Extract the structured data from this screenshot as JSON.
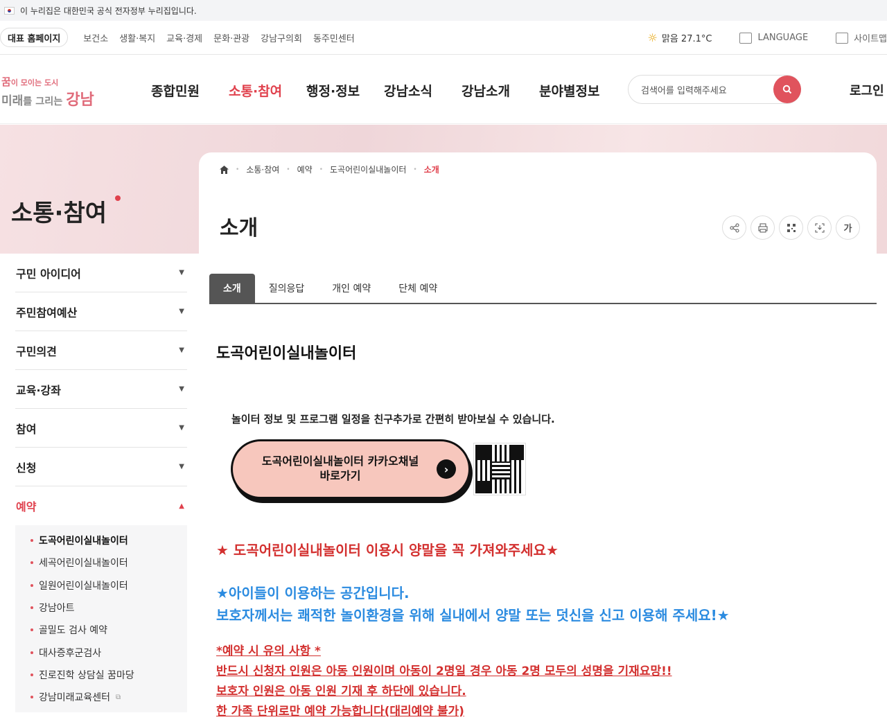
{
  "gov_notice": "이 누리집은 대한민국 공식 전자정부 누리집입니다.",
  "util": {
    "home_label": "대표 홈페이지",
    "links": [
      "보건소",
      "생활·복지",
      "교육·경제",
      "문화·관광",
      "강남구의회",
      "동주민센터"
    ],
    "weather": "맑음  27.1°C",
    "language": "LANGUAGE",
    "sitemap": "사이트맵"
  },
  "logo": {
    "line1a": "꿈",
    "line1b": "이 모이는 도시",
    "line2a": "미래",
    "line2b": "를 그리는 ",
    "line2c": "강남"
  },
  "gnb": {
    "items": [
      "종합민원",
      "소통·참여",
      "행정·정보",
      "강남소식",
      "강남소개",
      "분야별정보"
    ],
    "active_index": 1
  },
  "search": {
    "placeholder": "검색어를 입력해주세요"
  },
  "login": "로그인",
  "section_title": "소통·참여",
  "breadcrumb": [
    "소통·참여",
    "예약",
    "도곡어린이실내놀이터",
    "소개"
  ],
  "page_title": "소개",
  "tools": [
    "share-icon",
    "print-icon",
    "qr-icon",
    "download-icon",
    "font-size-icon"
  ],
  "font_tool_label": "가",
  "lnb": {
    "items": [
      "구민 아이디어",
      "주민참여예산",
      "구민의견",
      "교육·강좌",
      "참여",
      "신청",
      "예약"
    ],
    "sub": [
      "도곡어린이실내놀이터",
      "세곡어린이실내놀이터",
      "일원어린이실내놀이터",
      "강남아트",
      "골밀도 검사 예약",
      "대사증후군검사",
      "진로진학 상담실 꿈마당",
      "강남미래교육센터"
    ]
  },
  "tabs": [
    "소개",
    "질의응답",
    "개인 예약",
    "단체 예약"
  ],
  "content": {
    "title": "도곡어린이실내놀이터",
    "desc": "놀이터 정보 및 프로그램 일정을 친구추가로 간편히 받아보실 수 있습니다.",
    "kakao_line1": "도곡어린이실내놀이터 카카오채널",
    "kakao_line2": "바로가기",
    "warn1": "★ 도곡어린이실내놀이터 이용시 양말을 꼭 가져와주세요★",
    "blue1": "★아이들이 이용하는 공간입니다.",
    "blue2": "보호자께서는 쾌적한 놀이환경을 위해 실내에서 양말 또는 덧신을 신고 이용해 주세요!★",
    "red1": "*예약 시 유의 사항 *",
    "red2": "반드시 신청자 인원은 아동 인원이며 아동이 2명일 경우 아동 2명 모두의 성명을 기재요망!!",
    "red3": "보호자 인원은 아동 인원 기재 후 하단에 있습니다.",
    "red4": "한 가족 단위로만 예약 가능합니다(대리예약 불가)"
  },
  "colors": {
    "accent": "#e0414d",
    "blue": "#2b8be0",
    "red": "#d3302f"
  }
}
